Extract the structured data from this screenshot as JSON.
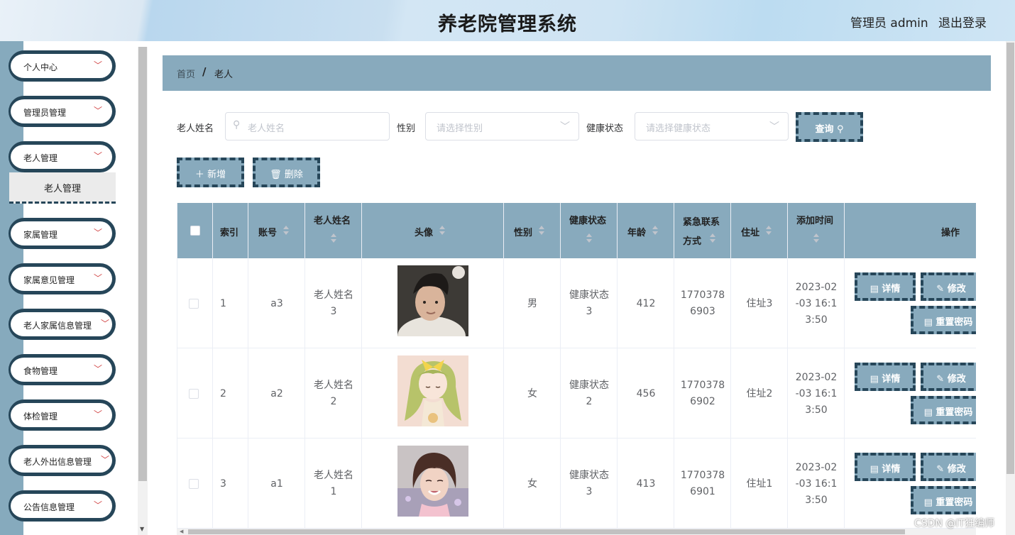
{
  "header": {
    "title": "养老院管理系统",
    "admin_label": "管理员 admin",
    "logout_label": "退出登录"
  },
  "sidebar": {
    "items": [
      {
        "label": "个人中心"
      },
      {
        "label": "管理员管理"
      },
      {
        "label": "老人管理"
      },
      {
        "label": "家属管理"
      },
      {
        "label": "家属意见管理"
      },
      {
        "label": "老人家属信息管理"
      },
      {
        "label": "食物管理"
      },
      {
        "label": "体检管理"
      },
      {
        "label": "老人外出信息管理"
      },
      {
        "label": "公告信息管理"
      }
    ],
    "submenu_active": "老人管理"
  },
  "breadcrumb": {
    "home": "首页",
    "separator": "/",
    "current": "老人"
  },
  "search": {
    "name_label": "老人姓名",
    "name_placeholder": "老人姓名",
    "gender_label": "性别",
    "gender_placeholder": "请选择性别",
    "health_label": "健康状态",
    "health_placeholder": "请选择健康状态",
    "query_button": "查询"
  },
  "actions": {
    "add_button": "新增",
    "delete_button": "删除"
  },
  "table": {
    "headers": {
      "index": "索引",
      "account": "账号",
      "name": "老人姓名",
      "avatar": "头像",
      "gender": "性别",
      "health": "健康状态",
      "age": "年龄",
      "contact": "紧急联系方式",
      "address": "住址",
      "added_time": "添加时间",
      "ops": "操作"
    },
    "rows": [
      {
        "index": "1",
        "account": "a3",
        "name": "老人姓名3",
        "gender": "男",
        "health": "健康状态3",
        "age": "412",
        "contact": "17703786903",
        "address": "住址3",
        "added_time": "2023-02-03 16:13:50"
      },
      {
        "index": "2",
        "account": "a2",
        "name": "老人姓名2",
        "gender": "女",
        "health": "健康状态2",
        "age": "456",
        "contact": "17703786902",
        "address": "住址2",
        "added_time": "2023-02-03 16:13:50"
      },
      {
        "index": "3",
        "account": "a1",
        "name": "老人姓名1",
        "gender": "女",
        "health": "健康状态3",
        "age": "413",
        "contact": "17703786901",
        "address": "住址1",
        "added_time": "2023-02-03 16:13:50"
      }
    ],
    "row_actions": {
      "detail": "详情",
      "edit": "修改",
      "reset": "重置密码"
    }
  },
  "watermark": "CSDN @IT狂编师",
  "colors": {
    "accent": "#88aabd",
    "border_dark": "#264659",
    "rail": "#86aabd"
  }
}
